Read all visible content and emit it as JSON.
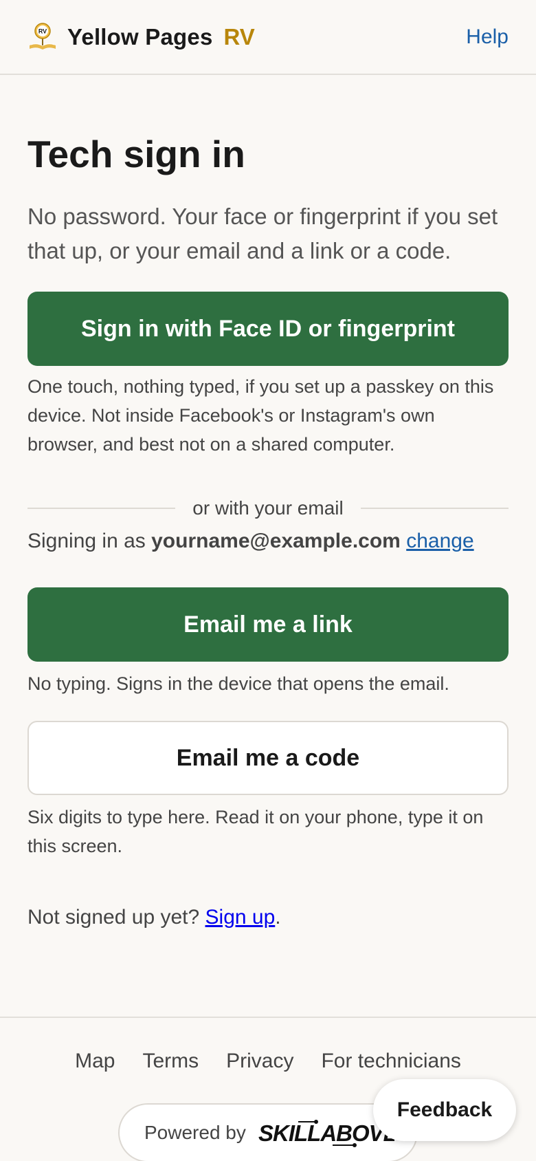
{
  "header": {
    "brand_name": "Yellow Pages",
    "brand_suffix": "RV",
    "logo_text": "RV",
    "help_label": "Help"
  },
  "main": {
    "title": "Tech sign in",
    "intro": "No password. Your face or fingerprint if you set that up, or your email and a link or a code.",
    "passkey_button": "Sign in with Face ID or fingerprint",
    "passkey_note": "One touch, nothing typed, if you set up a passkey on this device. Not inside Facebook's or Instagram's own browser, and best not on a shared computer.",
    "divider_text": "or with your email",
    "signing_as_prefix": "Signing in as ",
    "signing_as_email": "yourname@example.com",
    "change_label": "change",
    "email_link_button": "Email me a link",
    "email_link_note": "No typing. Signs in the device that opens the email.",
    "email_code_button": "Email me a code",
    "email_code_note": "Six digits to type here. Read it on your phone, type it on this screen.",
    "signup_prefix": "Not signed up yet? ",
    "signup_link": "Sign up",
    "signup_suffix": "."
  },
  "footer": {
    "links": [
      "Map",
      "Terms",
      "Privacy",
      "For technicians"
    ],
    "powered_by": "Powered by",
    "powered_logo_text": "SKILLABOVE"
  },
  "feedback_label": "Feedback",
  "colors": {
    "background": "#faf8f5",
    "primary_green": "#2e6f40",
    "brand_gold": "#b8860b",
    "link_blue": "#1a5fa8",
    "signup_link": "#0000ee"
  }
}
